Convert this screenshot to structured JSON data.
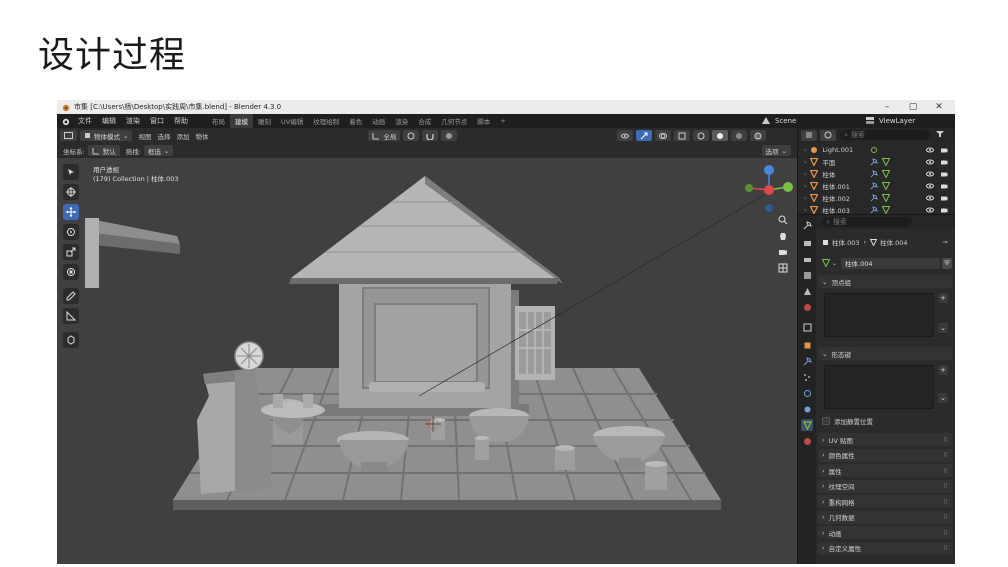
{
  "slide": {
    "title": "设计过程"
  },
  "window": {
    "title": "市集 [C:\\Users\\杨\\Desktop\\实践周\\市集.blend] - Blender 4.3.0",
    "min": "–",
    "max": "▢",
    "close": "✕"
  },
  "menubar": {
    "items": [
      "文件",
      "编辑",
      "渲染",
      "窗口",
      "帮助"
    ],
    "workspaces": [
      "布局",
      "建模",
      "雕刻",
      "UV编辑",
      "纹理绘制",
      "着色",
      "动画",
      "渲染",
      "合成",
      "几何节点",
      "脚本",
      "+"
    ],
    "active_workspace": "建模",
    "scene": "Scene",
    "view_layer": "ViewLayer"
  },
  "header": {
    "mode": "物体模式",
    "menus": [
      "视图",
      "选择",
      "添加",
      "物体"
    ],
    "transform": "全局",
    "coord_label": "坐标系:",
    "coord_value": "默认",
    "drag_label": "拖拽:",
    "drag_value": "框选",
    "options": "选项"
  },
  "viewport": {
    "view_name": "用户透视",
    "collection_info": "(179) Collection | 柱体.003"
  },
  "outliner": {
    "search_placeholder": "搜索",
    "rows": [
      "Light.001",
      "平面",
      "柱体",
      "柱体.001",
      "柱体.002",
      "柱体.003"
    ]
  },
  "properties": {
    "search_placeholder": "搜索",
    "breadcrumb_object": "柱体.003",
    "breadcrumb_data": "柱体.004",
    "mesh_name": "柱体.004",
    "sections": {
      "vertex_groups": "顶点组",
      "shape_keys": "形态键",
      "add_rest_position": "添加静置位置",
      "uv_maps": "UV 贴图",
      "color_attributes": "颜色属性",
      "attributes": "属性",
      "texture_space": "纹理空间",
      "remesh": "重构网格",
      "geometry_data": "几何数据",
      "animation": "动画",
      "custom_properties": "自定义属性"
    }
  },
  "colors": {
    "accent": "#3e6bb3",
    "gizmo_x": "#e04848",
    "gizmo_y": "#7ac143",
    "gizmo_z": "#4a86d8",
    "mesh_icon": "#e8964a"
  }
}
